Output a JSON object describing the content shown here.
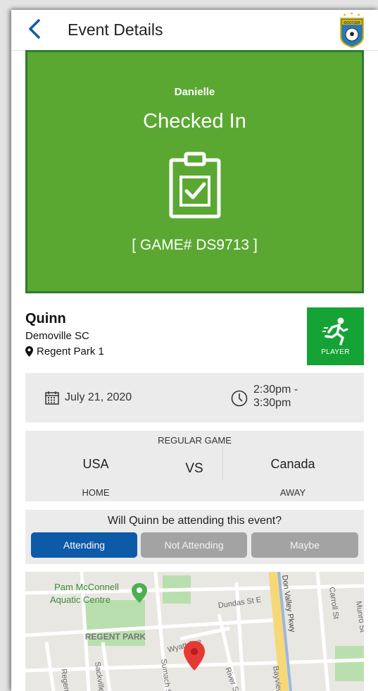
{
  "header": {
    "title": "Event Details",
    "logo_text": "SOCCER"
  },
  "checkin": {
    "name": "Danielle",
    "status": "Checked In",
    "game_number": "[ GAME# DS9713 ]"
  },
  "player": {
    "name": "Quinn",
    "club": "Demoville SC",
    "location": "Regent Park 1",
    "role": "PLAYER"
  },
  "schedule": {
    "date": "July 21, 2020",
    "time_start": "2:30pm -",
    "time_end": "3:30pm"
  },
  "match": {
    "type": "REGULAR GAME",
    "home_team": "USA",
    "away_team": "Canada",
    "vs": "VS",
    "home_label": "HOME",
    "away_label": "AWAY"
  },
  "rsvp": {
    "question": "Will Quinn be attending this event?",
    "options": [
      "Attending",
      "Not Attending",
      "Maybe"
    ],
    "selected": "Attending"
  },
  "map": {
    "labels": {
      "aquatic_1": "Pam McConnell",
      "aquatic_2": "Aquatic Centre",
      "regent_park": "REGENT PARK",
      "dundas": "Dundas St E",
      "don_valley": "Don Valley Pkwy",
      "carroll": "Carroll St",
      "munro": "Munro St",
      "wyatt": "Wyatt Ave",
      "sumach": "Sumach St",
      "sackville": "Sackville",
      "regent": "Regen",
      "river": "River St",
      "bayview": "Bayview"
    }
  },
  "colors": {
    "checkin_bg": "#5aa832",
    "checkin_border": "#2c7c2f",
    "role_badge": "#16a335",
    "attending": "#0d5aa8",
    "inactive_button": "#a3a3a3",
    "back_arrow": "#0d5aa8"
  }
}
